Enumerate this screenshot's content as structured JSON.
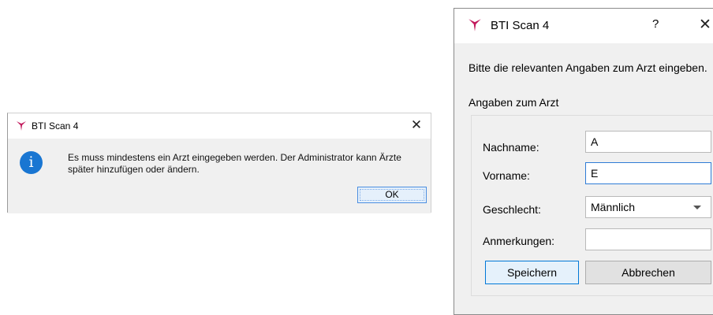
{
  "message_box": {
    "title": "BTI Scan 4",
    "close_glyph": "✕",
    "info_icon": "info-icon",
    "info_glyph": "i",
    "text": "Es muss mindestens ein Arzt eingegeben werden. Der Administrator kann Ärzte später hinzufügen oder ändern.",
    "ok_label": "OK"
  },
  "dialog": {
    "title": "BTI Scan 4",
    "help_glyph": "?",
    "close_glyph": "✕",
    "instruction": "Bitte die relevanten Angaben zum Arzt eingeben.",
    "group_title": "Angaben zum Arzt",
    "fields": {
      "nachname": {
        "label": "Nachname:",
        "value": "A"
      },
      "vorname": {
        "label": "Vorname:",
        "value": "E"
      },
      "geschlecht": {
        "label": "Geschlecht:",
        "value": "Männlich"
      },
      "anmerkungen": {
        "label": "Anmerkungen:",
        "value": ""
      }
    },
    "save_label": "Speichern",
    "cancel_label": "Abbrechen"
  },
  "colors": {
    "logo_magenta": "#c2185b",
    "info_blue": "#1976d2",
    "focus_blue": "#2e7cd6"
  }
}
